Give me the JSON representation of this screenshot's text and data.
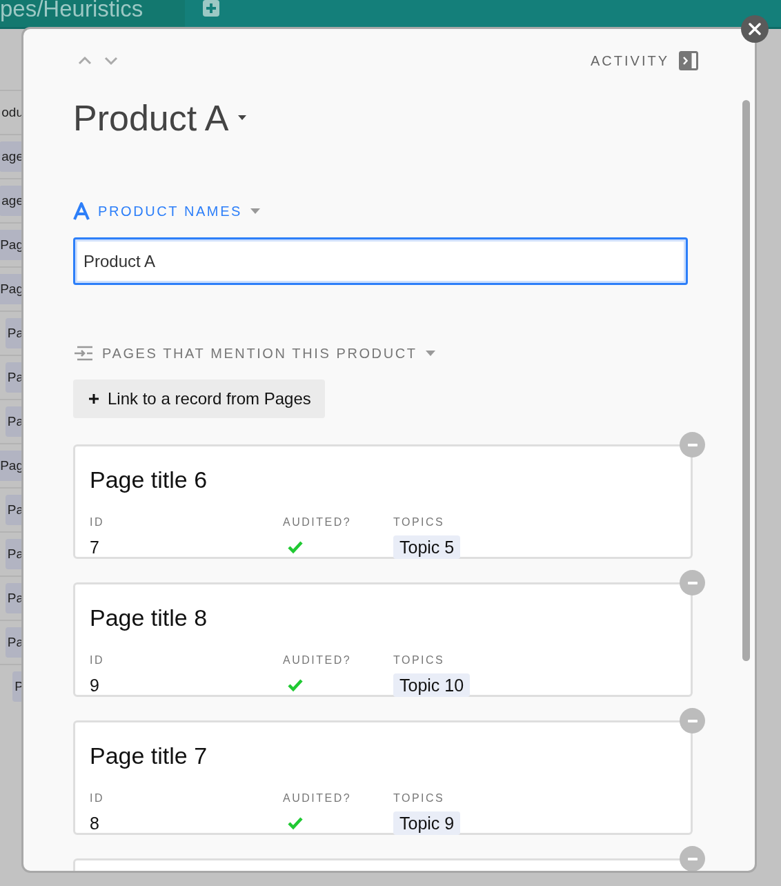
{
  "tab_bar": {
    "title": "pes/Heuristics"
  },
  "background_rows": [
    {
      "text": "odu",
      "tagged": false
    },
    {
      "text": "age",
      "tagged": true
    },
    {
      "text": "age",
      "tagged": true
    },
    {
      "text": "Pag",
      "tagged": true
    },
    {
      "text": "Pag",
      "tagged": true
    },
    {
      "text": "Pa",
      "tagged": true
    },
    {
      "text": "Pa",
      "tagged": true
    },
    {
      "text": "Pa",
      "tagged": true
    },
    {
      "text": "Pag",
      "tagged": true
    },
    {
      "text": "Pa",
      "tagged": true
    },
    {
      "text": "Pa",
      "tagged": true
    },
    {
      "text": "Pa",
      "tagged": true
    },
    {
      "text": "Pa",
      "tagged": true
    },
    {
      "text": "P",
      "tagged": true
    }
  ],
  "record": {
    "activity_label": "ACTIVITY",
    "title": "Product A",
    "fields": [
      {
        "kind": "text",
        "label": "PRODUCT NAMES",
        "value": "Product A"
      },
      {
        "kind": "links",
        "label": "PAGES THAT MENTION THIS PRODUCT",
        "link_button": "Link to a record from Pages",
        "records": [
          {
            "title": "Page title 6",
            "fields": [
              {
                "kind": "text",
                "label": "ID",
                "value": "7"
              },
              {
                "kind": "check",
                "label": "AUDITED?",
                "checked": true
              },
              {
                "kind": "tag",
                "label": "TOPICS",
                "value": "Topic 5"
              }
            ]
          },
          {
            "title": "Page title 8",
            "fields": [
              {
                "kind": "text",
                "label": "ID",
                "value": "9"
              },
              {
                "kind": "check",
                "label": "AUDITED?",
                "checked": true
              },
              {
                "kind": "tag",
                "label": "TOPICS",
                "value": "Topic 10"
              }
            ]
          },
          {
            "title": "Page title 7",
            "fields": [
              {
                "kind": "text",
                "label": "ID",
                "value": "8"
              },
              {
                "kind": "check",
                "label": "AUDITED?",
                "checked": true
              },
              {
                "kind": "tag",
                "label": "TOPICS",
                "value": "Topic 9"
              }
            ]
          }
        ]
      }
    ]
  }
}
